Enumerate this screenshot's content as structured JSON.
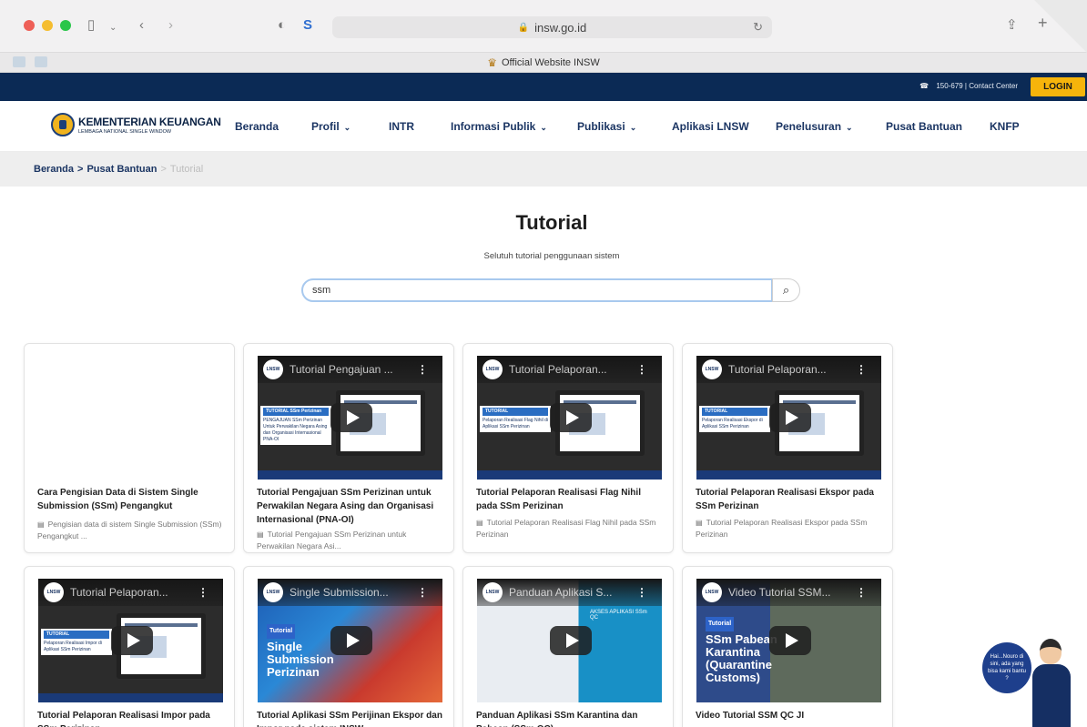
{
  "browser": {
    "url": "insw.go.id",
    "tab_title": "Official Website INSW"
  },
  "topbar": {
    "contact": "150-679 | Contact Center",
    "login_label": "LOGIN"
  },
  "brand": {
    "title": "KEMENTERIAN KEUANGAN",
    "subtitle": "LEMBAGA NATIONAL SINGLE WINDOW"
  },
  "nav": {
    "items": [
      {
        "label": "Beranda"
      },
      {
        "label": "Profil"
      },
      {
        "label": "INTR"
      },
      {
        "label": "Informasi Publik"
      },
      {
        "label": "Publikasi"
      },
      {
        "label": "Aplikasi LNSW"
      },
      {
        "label": "Penelusuran"
      },
      {
        "label": "Pusat Bantuan"
      },
      {
        "label": "KNFP"
      }
    ]
  },
  "breadcrumb": {
    "home": "Beranda",
    "sep": ">",
    "section": "Pusat Bantuan",
    "current": "Tutorial"
  },
  "page": {
    "title": "Tutorial",
    "subtitle": "Selutuh tutorial penggunaan sistem"
  },
  "search": {
    "value": "ssm"
  },
  "cards": [
    {
      "title": "Cara Pengisian Data di Sistem Single Submission (SSm) Pengangkut",
      "desc": "Pengisian data di sistem Single Submission (SSm) Pengangkut ..."
    },
    {
      "thumb_title": "Tutorial Pengajuan ...",
      "thumb_badge_head": "TUTORIAL SSm Perizinan",
      "thumb_badge_text": "PENGAJUAN SSm Perizinan Untuk Perwakilan Negara Asing dan Organisasi Internasional PNA-OI",
      "title": "Tutorial Pengajuan SSm Perizinan untuk Perwakilan Negara Asing dan Organisasi Internasional (PNA-OI)",
      "desc": "Tutorial Pengajuan SSm Perizinan untuk Perwakilan Negara Asi..."
    },
    {
      "thumb_title": "Tutorial Pelaporan...",
      "thumb_badge_head": "TUTORIAL",
      "thumb_badge_text": "Pelaporan Realisasi Flag Nihil di Aplikasi SSm Perizinan",
      "title": "Tutorial Pelaporan Realisasi Flag Nihil pada SSm Perizinan",
      "desc": "Tutorial Pelaporan Realisasi Flag Nihil pada SSm Perizinan"
    },
    {
      "thumb_title": "Tutorial Pelaporan...",
      "thumb_badge_head": "TUTORIAL",
      "thumb_badge_text": "Pelaporan Realisasi Ekspor di Aplikasi SSm Perizinan",
      "title": "Tutorial Pelaporan Realisasi Ekspor pada SSm Perizinan",
      "desc": "Tutorial Pelaporan Realisasi Ekspor pada SSm Perizinan"
    },
    {
      "thumb_title": "Tutorial Pelaporan...",
      "thumb_badge_head": "TUTORIAL",
      "thumb_badge_text": "Pelaporan Realisasi Impor di Aplikasi SSm Perizinan",
      "title": "Tutorial Pelaporan Realisasi Impor pada SSm Perizinan"
    },
    {
      "thumb_title": "Single Submission...",
      "thumb_tag": "Tutorial",
      "thumb_big": "Single Submission Perizinan",
      "title": "Tutorial Aplikasi SSm Perijinan Ekspor dan Impor pada sistem INSW"
    },
    {
      "thumb_title": "Panduan Aplikasi S...",
      "thumb_big": "AKSES APLIKASI SSm QC",
      "title": "Panduan Aplikasi SSm Karantina dan Pabean (SSm QC)"
    },
    {
      "thumb_title": "Video Tutorial SSM...",
      "thumb_tag": "Tutorial",
      "thumb_big": "SSm Pabean Karantina (Quarantine Customs)",
      "title": "Video Tutorial SSM QC JI"
    }
  ],
  "chat": {
    "text": "Hai...Nouro di sini, ada yang bisa kami bantu ?"
  },
  "thumb_logo": "LNSW"
}
